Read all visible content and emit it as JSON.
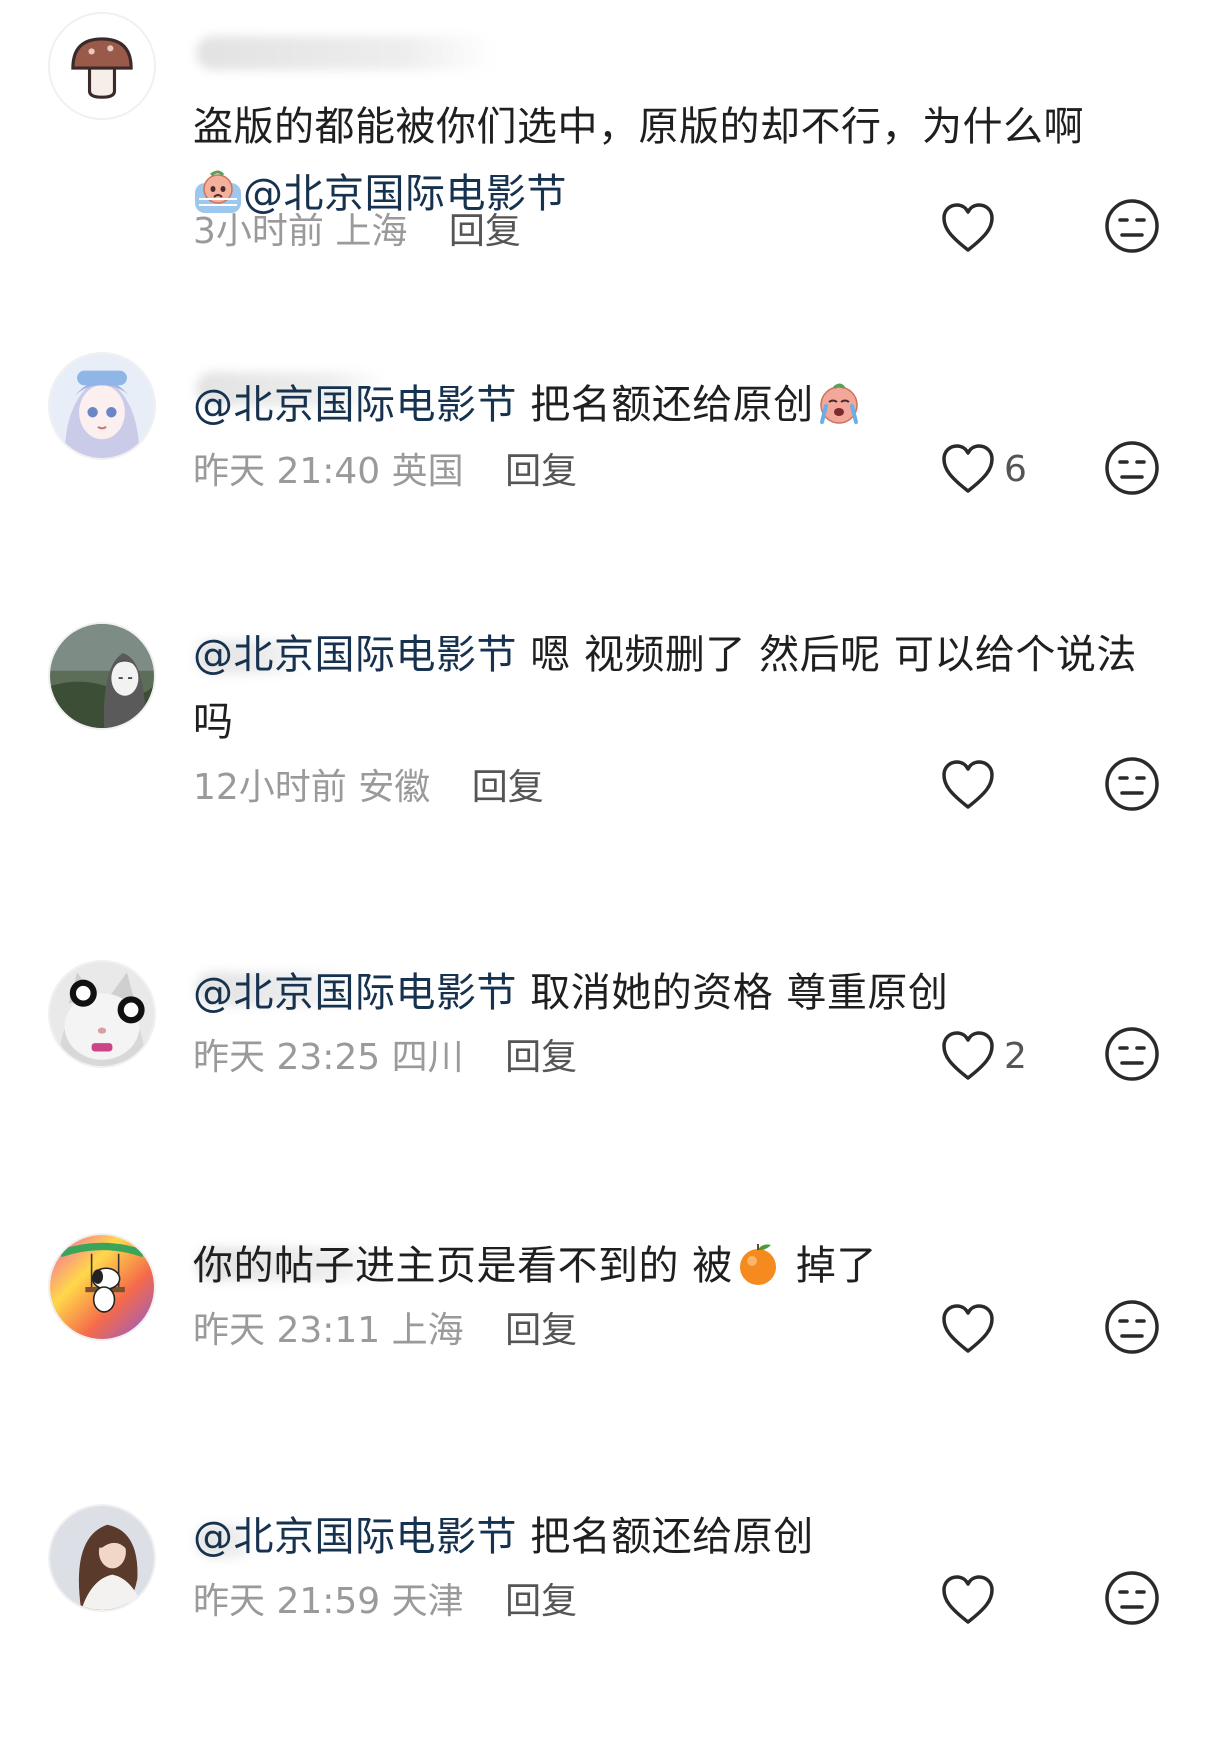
{
  "comments": [
    {
      "text_before": "盗版的都能被你们选中，原版的却不行，为什么啊",
      "mention": "@北京国际电影节",
      "text_after": "",
      "time": "3小时前",
      "location": "上海",
      "reply_label": "回复",
      "likes": "",
      "avatar_icon": "mushroom-icon",
      "emoji_icon": "crying-emoji-icon"
    },
    {
      "text_before": "",
      "mention": "@北京国际电影节",
      "text_after": " 把名额还给原创",
      "time": "昨天 21:40",
      "location": "英国",
      "reply_label": "回复",
      "likes": "6",
      "avatar_icon": "anime-girl-avatar-icon",
      "emoji_icon": "crying-emoji-icon"
    },
    {
      "text_before": "",
      "mention": "@北京国际电影节",
      "text_after": " 嗯 视频删了 然后呢 可以给个说法吗",
      "time": "12小时前",
      "location": "安徽",
      "reply_label": "回复",
      "likes": "",
      "avatar_icon": "ink-portrait-avatar-icon"
    },
    {
      "text_before": "",
      "mention": "@北京国际电影节",
      "text_after": " 取消她的资格 尊重原创",
      "time": "昨天 23:25",
      "location": "四川",
      "reply_label": "回复",
      "likes": "2",
      "avatar_icon": "cat-sunglasses-avatar-icon"
    },
    {
      "text_before": "你的帖子进主页是看不到的 被",
      "mention": "",
      "text_after": " 掉了",
      "time": "昨天 23:11",
      "location": "上海",
      "reply_label": "回复",
      "likes": "",
      "avatar_icon": "snoopy-avatar-icon",
      "emoji_icon": "orange-emoji-icon"
    },
    {
      "text_before": "",
      "mention": "@北京国际电影节",
      "text_after": " 把名额还给原创",
      "time": "昨天 21:59",
      "location": "天津",
      "reply_label": "回复",
      "likes": "",
      "avatar_icon": "girl-portrait-avatar-icon"
    }
  ],
  "colors": {
    "mention": "#17324f",
    "meta": "#9a9a9a",
    "reply": "#555555",
    "text": "#1f1f1f"
  }
}
